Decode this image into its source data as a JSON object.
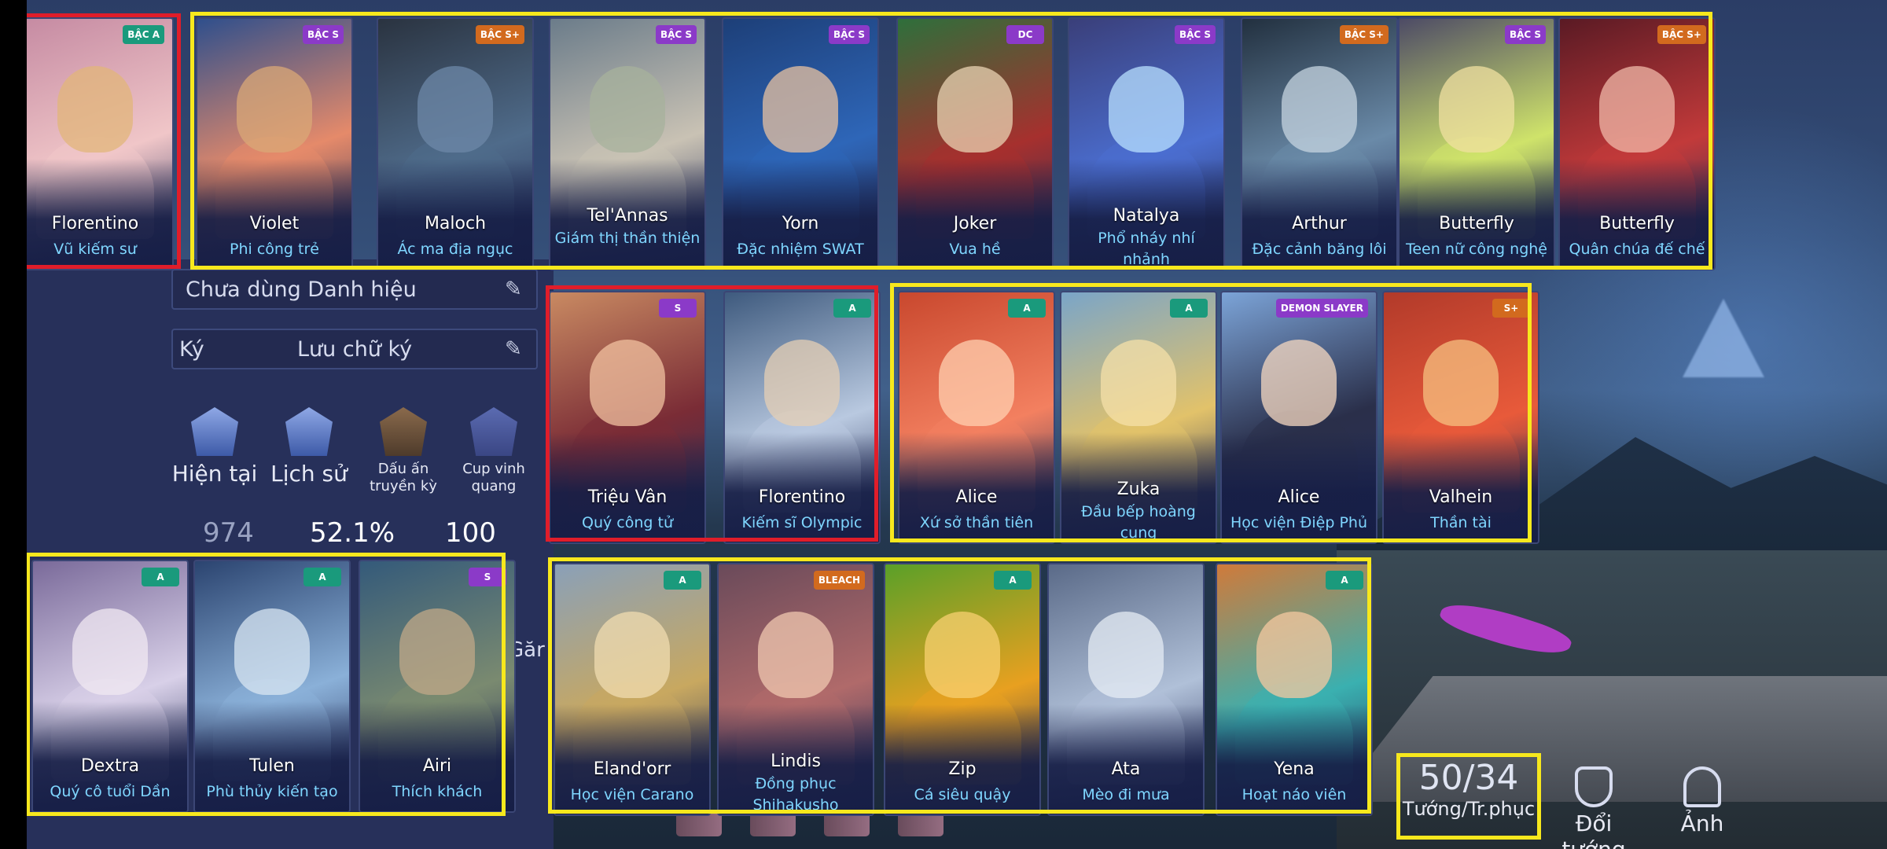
{
  "profile": {
    "title_field": "Chưa dùng Danh hiệu",
    "signature_label": "Ký",
    "signature_field": "Lưu chữ ký",
    "partial_text": "Găr",
    "achievements": [
      {
        "label": "Hiện tại",
        "icon": "rank-current-icon"
      },
      {
        "label": "Lịch sử",
        "icon": "rank-history-icon"
      },
      {
        "label": "Dấu ấn truyền kỳ",
        "icon": "legend-mark-icon"
      },
      {
        "label": "Cup vinh quang",
        "icon": "glory-cup-icon"
      }
    ],
    "stats": [
      "974",
      "52.1%",
      "100"
    ]
  },
  "cards": [
    {
      "hero": "Florentino",
      "skin": "Vũ kiếm sư",
      "badge": "BẬC A",
      "tier": "a"
    },
    {
      "hero": "Violet",
      "skin": "Phi công trẻ",
      "badge": "BẬC S",
      "tier": "s"
    },
    {
      "hero": "Maloch",
      "skin": "Ác ma địa ngục",
      "badge": "BẬC S+",
      "tier": "sp"
    },
    {
      "hero": "Tel'Annas",
      "skin": "Giám thị thần thiện",
      "badge": "BẬC S",
      "tier": "s"
    },
    {
      "hero": "Yorn",
      "skin": "Đặc nhiệm SWAT",
      "badge": "BẬC S",
      "tier": "s"
    },
    {
      "hero": "Joker",
      "skin": "Vua hề",
      "badge": "DC",
      "tier": "s"
    },
    {
      "hero": "Natalya",
      "skin": "Phổ nháy nhí nhảnh",
      "badge": "BẬC S",
      "tier": "s"
    },
    {
      "hero": "Arthur",
      "skin": "Đặc cảnh băng lôi",
      "badge": "BẬC S+",
      "tier": "sp"
    },
    {
      "hero": "Butterfly",
      "skin": "Teen nữ công nghệ",
      "badge": "BẬC S",
      "tier": "s"
    },
    {
      "hero": "Butterfly",
      "skin": "Quân chúa đế chế",
      "badge": "BẬC S+",
      "tier": "sp"
    },
    {
      "hero": "Triệu Vân",
      "skin": "Quý công tử",
      "badge": "S",
      "tier": "s"
    },
    {
      "hero": "Florentino",
      "skin": "Kiếm sĩ Olympic",
      "badge": "A",
      "tier": "a"
    },
    {
      "hero": "Alice",
      "skin": "Xứ sở thần tiên",
      "badge": "A",
      "tier": "a"
    },
    {
      "hero": "Zuka",
      "skin": "Đầu bếp hoàng cung",
      "badge": "A",
      "tier": "a"
    },
    {
      "hero": "Alice",
      "skin": "Học viện Điệp Phủ",
      "badge": "DEMON SLAYER",
      "tier": "s"
    },
    {
      "hero": "Valhein",
      "skin": "Thần tài",
      "badge": "S+",
      "tier": "sp"
    },
    {
      "hero": "Dextra",
      "skin": "Quý cô tuổi Dần",
      "badge": "A",
      "tier": "a"
    },
    {
      "hero": "Tulen",
      "skin": "Phù thủy kiến tạo",
      "badge": "A",
      "tier": "a"
    },
    {
      "hero": "Airi",
      "skin": "Thích khách",
      "badge": "S",
      "tier": "s"
    },
    {
      "hero": "Eland'orr",
      "skin": "Học viện Carano",
      "badge": "A",
      "tier": "a"
    },
    {
      "hero": "Lindis",
      "skin": "Đồng phục Shihakusho",
      "badge": "BLEACH",
      "tier": "sp"
    },
    {
      "hero": "Zip",
      "skin": "Cá siêu quậy",
      "badge": "A",
      "tier": "a"
    },
    {
      "hero": "Ata",
      "skin": "Mèo đi mưa",
      "badge": "",
      "tier": "a"
    },
    {
      "hero": "Yena",
      "skin": "Hoạt náo viên",
      "badge": "A",
      "tier": "a"
    }
  ],
  "counter": {
    "value": "50/34",
    "label": "Tướng/Tr.phục"
  },
  "nav": {
    "swap_label": "Đổi tướng",
    "photo_label": "Ảnh"
  },
  "colors": {
    "yellow_frame": "#f7e81d",
    "red_frame": "#e01d2a",
    "skin_text": "#7fd6ff"
  }
}
